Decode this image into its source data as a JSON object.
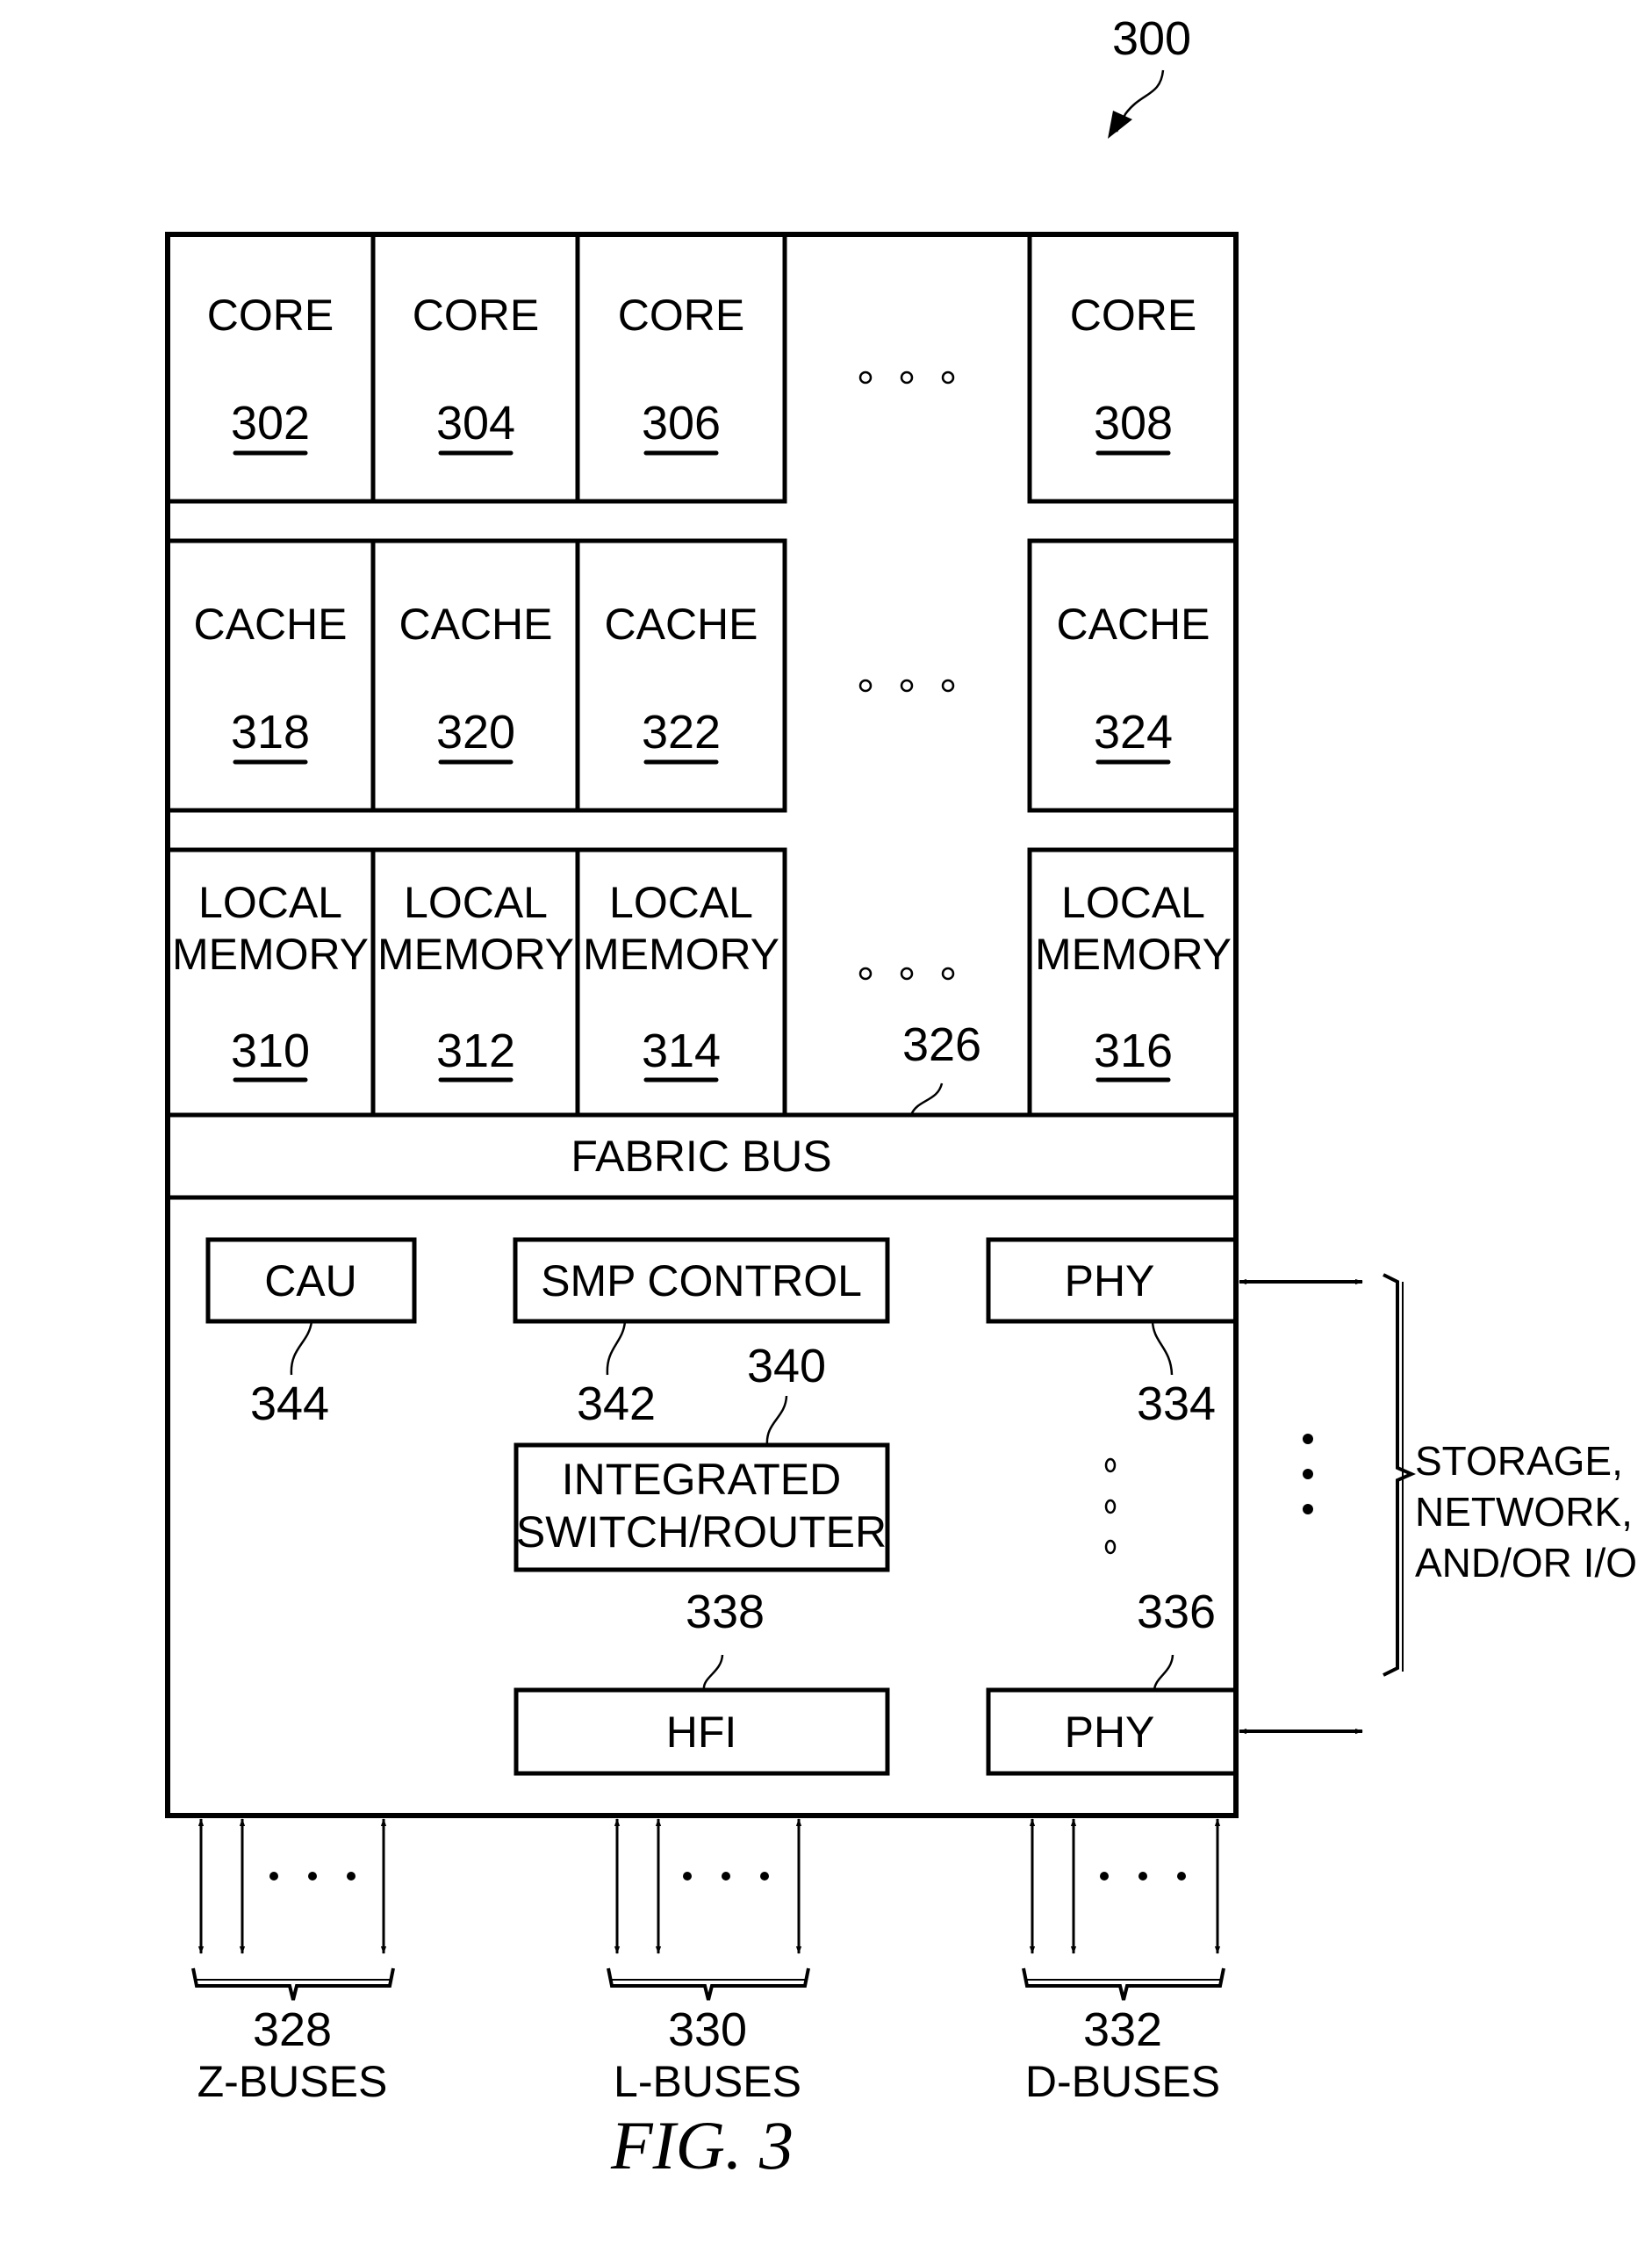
{
  "figure": {
    "ref": "300",
    "caption": "FIG. 3"
  },
  "cores": [
    {
      "label": "CORE",
      "ref": "302"
    },
    {
      "label": "CORE",
      "ref": "304"
    },
    {
      "label": "CORE",
      "ref": "306"
    },
    {
      "label": "CORE",
      "ref": "308"
    }
  ],
  "caches": [
    {
      "label": "CACHE",
      "ref": "318"
    },
    {
      "label": "CACHE",
      "ref": "320"
    },
    {
      "label": "CACHE",
      "ref": "322"
    },
    {
      "label": "CACHE",
      "ref": "324"
    }
  ],
  "local_memories": [
    {
      "line1": "LOCAL",
      "line2": "MEMORY",
      "ref": "310"
    },
    {
      "line1": "LOCAL",
      "line2": "MEMORY",
      "ref": "312"
    },
    {
      "line1": "LOCAL",
      "line2": "MEMORY",
      "ref": "314"
    },
    {
      "line1": "LOCAL",
      "line2": "MEMORY",
      "ref": "316"
    }
  ],
  "fabric_bus": {
    "label": "FABRIC BUS",
    "ref": "326"
  },
  "units": {
    "cau": {
      "label": "CAU",
      "ref": "344"
    },
    "smp_control": {
      "label": "SMP CONTROL",
      "ref": "342"
    },
    "switch": {
      "line1": "INTEGRATED",
      "line2": "SWITCH/ROUTER",
      "ref": "340"
    },
    "hfi": {
      "label": "HFI",
      "ref": "338"
    },
    "phy_top": {
      "label": "PHY",
      "ref": "334"
    },
    "phy_bottom": {
      "label": "PHY",
      "ref": "336"
    }
  },
  "external": {
    "line1": "STORAGE,",
    "line2": "NETWORK,",
    "line3": "AND/OR I/O"
  },
  "buses": [
    {
      "ref": "328",
      "label": "Z-BUSES"
    },
    {
      "ref": "330",
      "label": "L-BUSES"
    },
    {
      "ref": "332",
      "label": "D-BUSES"
    }
  ]
}
